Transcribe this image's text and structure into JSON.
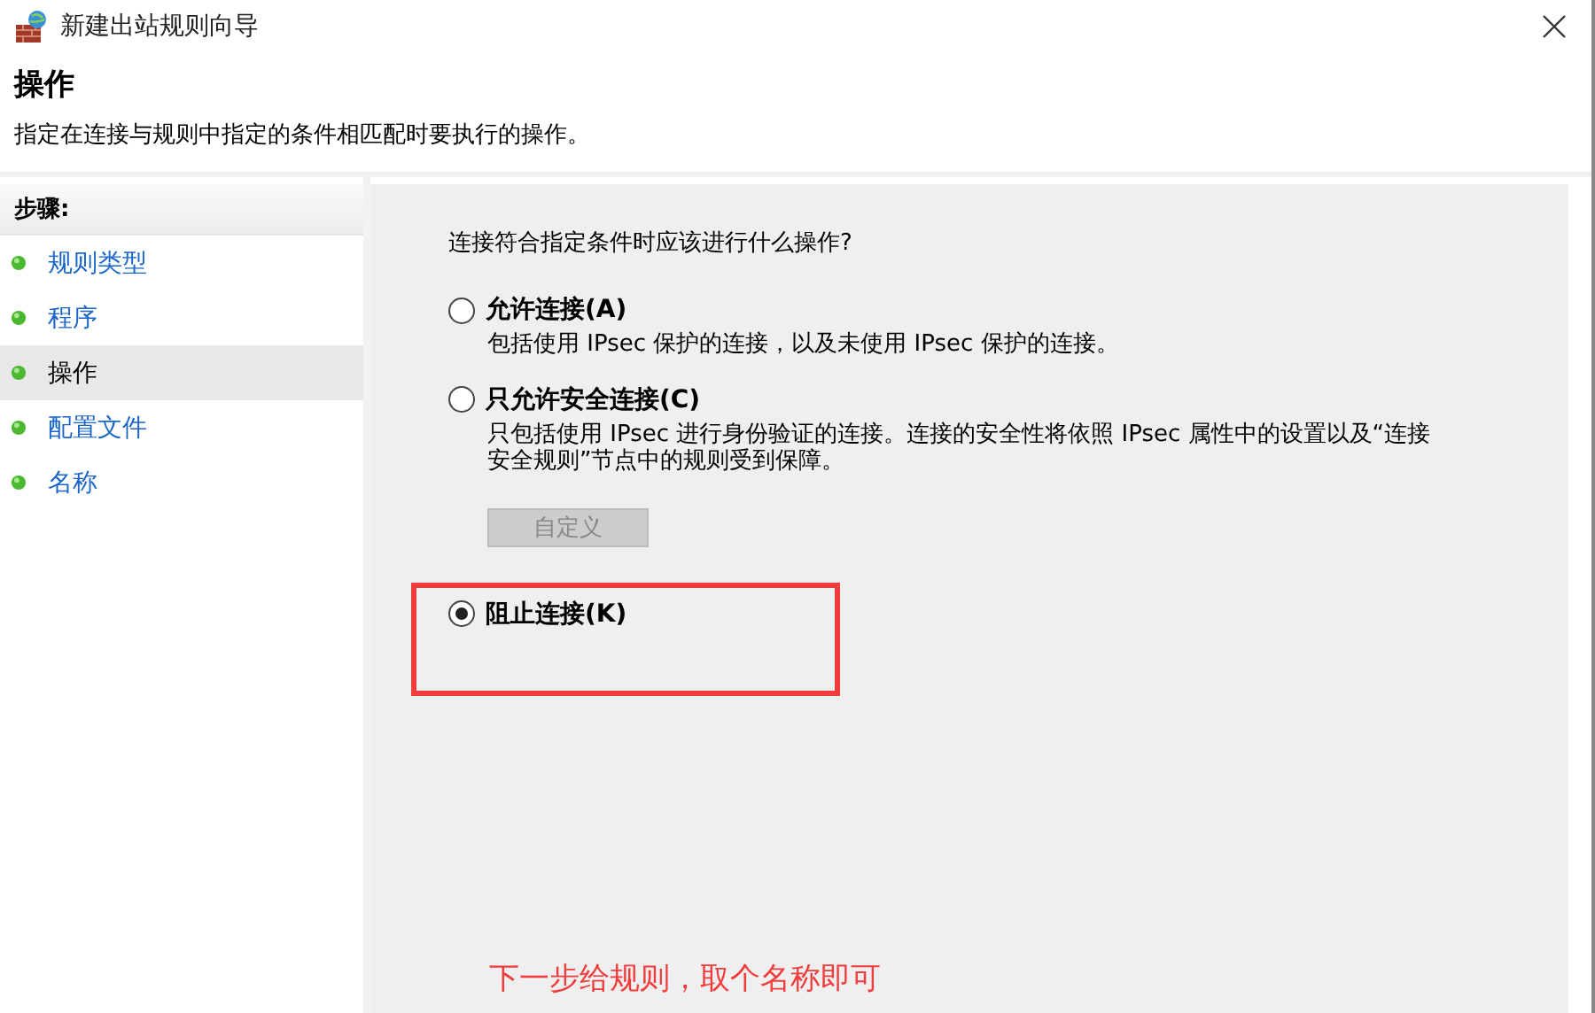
{
  "window": {
    "title": "新建出站规则向导"
  },
  "header": {
    "title": "操作",
    "subtitle": "指定在连接与规则中指定的条件相匹配时要执行的操作。"
  },
  "sidebar": {
    "heading": "步骤:",
    "items": [
      {
        "label": "规则类型",
        "selected": false
      },
      {
        "label": "程序",
        "selected": false
      },
      {
        "label": "操作",
        "selected": true
      },
      {
        "label": "配置文件",
        "selected": false
      },
      {
        "label": "名称",
        "selected": false
      }
    ]
  },
  "main": {
    "question": "连接符合指定条件时应该进行什么操作?",
    "options": [
      {
        "label": "允许连接(A)",
        "selected": false,
        "highlighted": false,
        "description": "包括使用 IPsec 保护的连接，以及未使用 IPsec 保护的连接。"
      },
      {
        "label": "只允许安全连接(C)",
        "selected": false,
        "highlighted": false,
        "description": "只包括使用 IPsec 进行身份验证的连接。连接的安全性将依照 IPsec 属性中的设置以及“连接安全规则”节点中的规则受到保障。",
        "button": {
          "label": "自定义",
          "disabled": true
        }
      },
      {
        "label": "阻止连接(K)",
        "selected": true,
        "highlighted": true
      }
    ],
    "annotation": "下一步给规则，取个名称即可"
  }
}
